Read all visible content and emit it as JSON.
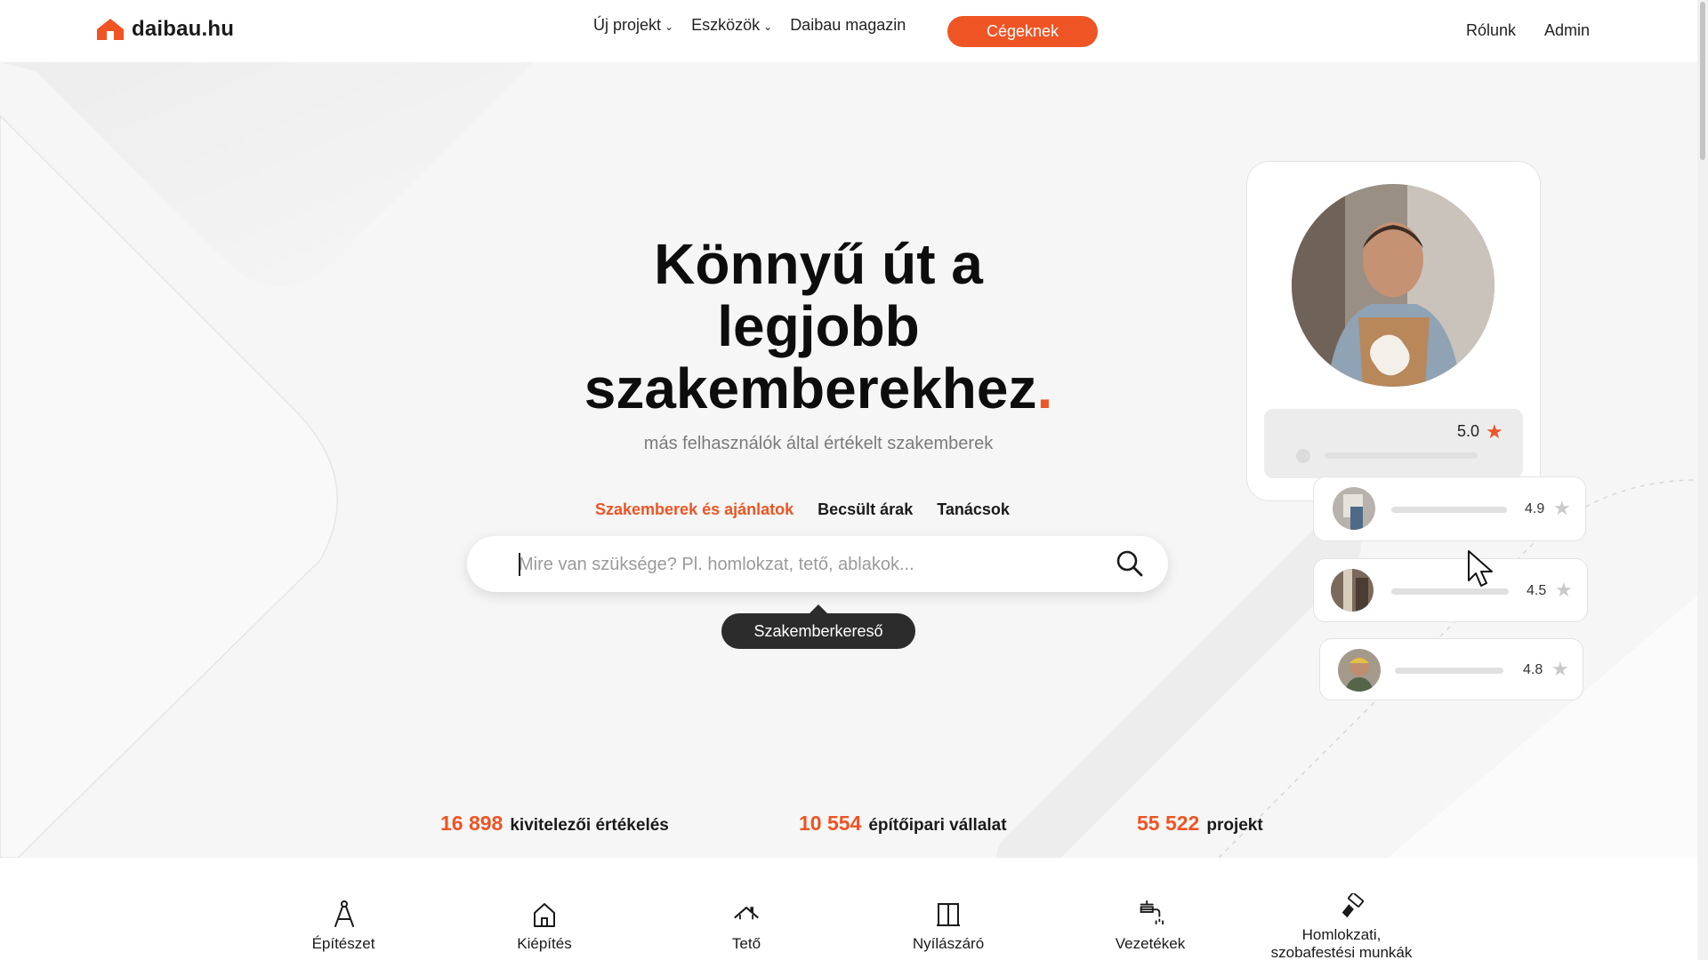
{
  "header": {
    "logo": "daibau.hu",
    "nav": [
      {
        "label": "Új projekt",
        "has_dropdown": true
      },
      {
        "label": "Eszközök",
        "has_dropdown": true
      },
      {
        "label": "Daibau magazin",
        "has_dropdown": false
      }
    ],
    "cta": "Cégeknek",
    "right_links": [
      "Rólunk",
      "Admin"
    ]
  },
  "hero": {
    "title_line1": "Könnyű út a",
    "title_line2": "legjobb",
    "title_line3": "szakemberekhez",
    "title_dot": ".",
    "subtitle": "más felhasználók által értékelt szakemberek"
  },
  "search_tabs": [
    {
      "label": "Szakemberek és ajánlatok",
      "active": true
    },
    {
      "label": "Becsült árak",
      "active": false
    },
    {
      "label": "Tanácsok",
      "active": false
    }
  ],
  "search": {
    "placeholder": "Mire van szüksége? Pl. homlokzat, tető, ablakok...",
    "value": "",
    "tooltip": "Szakemberkereső"
  },
  "profile_card": {
    "main_rating": "5.0",
    "reviews": [
      {
        "score": "4.9"
      },
      {
        "score": "4.5"
      },
      {
        "score": "4.8"
      }
    ]
  },
  "stats": [
    {
      "number": "16 898",
      "label": "kivitelezői értékelés"
    },
    {
      "number": "10 554",
      "label": "építőipari vállalat"
    },
    {
      "number": "55 522",
      "label": "projekt"
    }
  ],
  "categories": [
    {
      "label": "Építészet",
      "icon": "compass-icon"
    },
    {
      "label": "Kiépítés",
      "icon": "house-icon"
    },
    {
      "label": "Tető",
      "icon": "roof-icon"
    },
    {
      "label": "Nyílászáró",
      "icon": "window-icon"
    },
    {
      "label": "Vezetékek",
      "icon": "faucet-icon"
    },
    {
      "label_line1": "Homlokzati,",
      "label_line2": "szobafestési munkák",
      "icon": "paint-roller-icon"
    }
  ],
  "colors": {
    "accent": "#ee5424",
    "background": "#f6f6f6",
    "tooltip_bg": "#2c2c2c"
  }
}
